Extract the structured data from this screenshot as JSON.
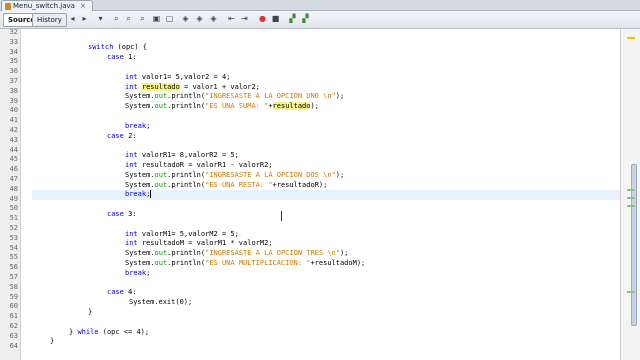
{
  "tab": {
    "title": "Menu_switch.java",
    "close": "×"
  },
  "toolbar": {
    "source_label": "Source",
    "history_label": "History"
  },
  "line_numbers": [
    "32",
    "33",
    "34",
    "35",
    "36",
    "37",
    "38",
    "39",
    "40",
    "41",
    "42",
    "43",
    "44",
    "45",
    "46",
    "47",
    "48",
    "49",
    "50",
    "51",
    "52",
    "53",
    "54",
    "55",
    "56",
    "57",
    "58",
    "59",
    "60",
    "61",
    "62",
    "63",
    "64"
  ],
  "code": {
    "l34_kw": "switch",
    "l34_rest": " (opc) {",
    "l35_kw": "case",
    "l35_rest": " 1:",
    "l37_kw": "int",
    "l37_rest": " valor1= 5,valor2 = 4;",
    "l38_kw": "int",
    "l38_var": "resultado",
    "l38_rest": " = valor1 + valor2;",
    "l39_a": "System.",
    "l39_out": "out",
    "l39_b": ".println(",
    "l39_str": "\"INGRESASTE A LA OPCION UNO \\n\"",
    "l39_c": ");",
    "l40_a": "System.",
    "l40_out": "out",
    "l40_b": ".println(",
    "l40_str": "\"ES UNA SUMA: \"",
    "l40_plus": "+",
    "l40_var": "resultado",
    "l40_c": ");",
    "l42_kw": "break",
    "l42_rest": ";",
    "l43_kw": "case",
    "l43_rest": " 2:",
    "l45_kw": "int",
    "l45_rest": " valorR1= 8,valorR2 = 5;",
    "l46_kw": "int",
    "l46_rest": " resultadoR = valorR1 - valorR2;",
    "l47_a": "System.",
    "l47_out": "out",
    "l47_b": ".println(",
    "l47_str": "\"INGRESASTE A LA OPCION DOS \\n\"",
    "l47_c": ");",
    "l48_a": "System.",
    "l48_out": "out",
    "l48_b": ".println(",
    "l48_str": "\"ES UNA RESTA: \"",
    "l48_c": "+resultadoR);",
    "l49_kw": "break",
    "l49_rest": ";",
    "l51_kw": "case",
    "l51_rest": " 3:",
    "l53_kw": "int",
    "l53_rest": " valorM1= 5,valorM2 = 5;",
    "l54_kw": "int",
    "l54_rest": " resultadoM = valorM1 * valorM2;",
    "l55_a": "System.",
    "l55_out": "out",
    "l55_b": ".println(",
    "l55_str": "\"INGRESASTE A LA OPCION TRES \\n\"",
    "l55_c": ");",
    "l56_a": "System.",
    "l56_out": "out",
    "l56_b": ".println(",
    "l56_str": "\"ES UNA MULTIPLICACION: \"",
    "l56_c": "+resultadoM);",
    "l57_kw": "break",
    "l57_rest": ";",
    "l59_kw": "case",
    "l59_rest": " 4:",
    "l60": "System.exit(0);",
    "l61": "}",
    "l63_close": "} ",
    "l63_kw": "while",
    "l63_rest": " (opc <= 4);",
    "l64": "}"
  },
  "colors": {
    "keyword": "#0000e6",
    "string": "#ce7b00",
    "field": "#009900",
    "highlight": "#f5f58a",
    "current_line": "#e8f2fe"
  }
}
